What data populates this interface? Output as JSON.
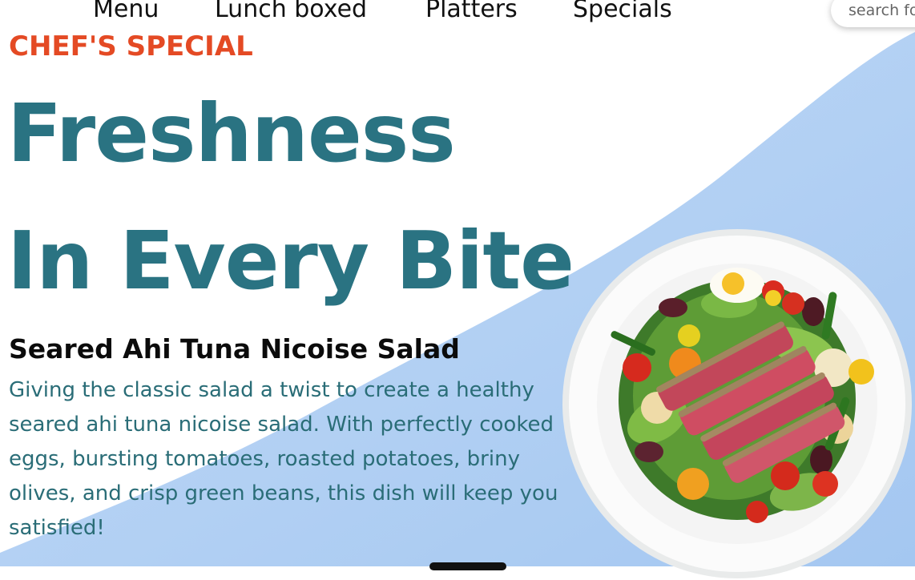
{
  "nav": {
    "items": [
      "Menu",
      "Lunch boxed",
      "Platters",
      "Specials"
    ]
  },
  "search": {
    "placeholder": "search for"
  },
  "hero": {
    "kicker": "CHEF'S SPECIAL",
    "headline_line1": "Freshness",
    "headline_line2": "In Every Bite",
    "dish_title": "Seared Ahi Tuna Nicoise Salad",
    "description": "Giving the classic salad a twist to create a healthy seared ahi tuna nicoise salad. With perfectly cooked eggs, bursting tomatoes, roasted potatoes, briny olives, and crisp green beans, this dish will keep you satisfied!"
  },
  "colors": {
    "accent_orange": "#e44a24",
    "headline_teal": "#2a7382",
    "description_teal": "#2a6d77",
    "wave_blue": "#aecdf2"
  }
}
